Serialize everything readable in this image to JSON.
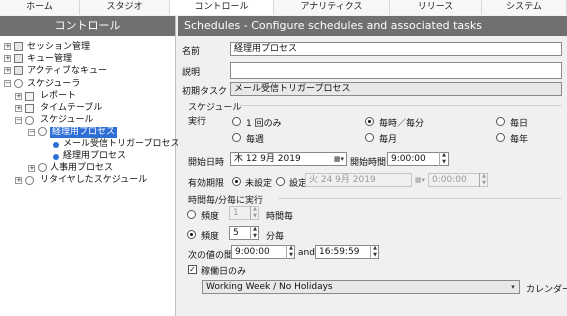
{
  "tabs": [
    "ホーム",
    "スタジオ",
    "コントロール",
    "アナリティクス",
    "リリース",
    "システム"
  ],
  "left": {
    "title": "コントロール",
    "tree": [
      {
        "label": "セッション管理"
      },
      {
        "label": "キュー管理"
      },
      {
        "label": "アクティブなキュー"
      },
      {
        "label": "スケジューラ"
      },
      {
        "label": "レポート"
      },
      {
        "label": "タイムテーブル"
      },
      {
        "label": "スケジュール"
      },
      {
        "label": "経理用プロセス"
      },
      {
        "label": "メール受信トリガープロセス"
      },
      {
        "label": "経理用プロセス"
      },
      {
        "label": "人事用プロセス"
      },
      {
        "label": "リタイヤしたスケジュール"
      }
    ]
  },
  "right": {
    "title": "Schedules - Configure schedules and associated tasks",
    "name_label": "名前",
    "name_value": "経理用プロセス",
    "desc_label": "説明",
    "desc_value": "",
    "initial_task_label": "初期タスク",
    "initial_task_value": "メール受信トリガープロセス",
    "schedule_section": "スケジュール",
    "run_label": "実行",
    "run_options": [
      "1 回のみ",
      "毎時／毎分",
      "毎日",
      "毎週",
      "毎月",
      "毎年"
    ],
    "start_datetime_label": "開始日時",
    "start_date_value": "木 12 9月  2019",
    "start_time_label": "開始時間",
    "start_time_value": "9:00:00",
    "expiry_label": "有効期限",
    "expiry_none": "未設定",
    "expiry_set": "設定",
    "expiry_date_value": "火 24 9月  2019",
    "expiry_time_value": "0:00:00",
    "hourly_section": "時間毎/分毎に実行",
    "freq1_label": "頻度",
    "freq1_value": "1",
    "freq1_unit": "時間毎",
    "freq2_label": "頻度",
    "freq2_value": "5",
    "freq2_unit": "分毎",
    "between_label": "次の値の間",
    "between_start": "9:00:00",
    "and_label": "and",
    "between_end": "16:59:59",
    "workdays_label": "稼働日のみ",
    "calendar_value": "Working Week / No Holidays",
    "calendar_label": "カレンダー",
    "colors": {
      "header": "#707070",
      "selection": "#2f6fd6"
    }
  }
}
